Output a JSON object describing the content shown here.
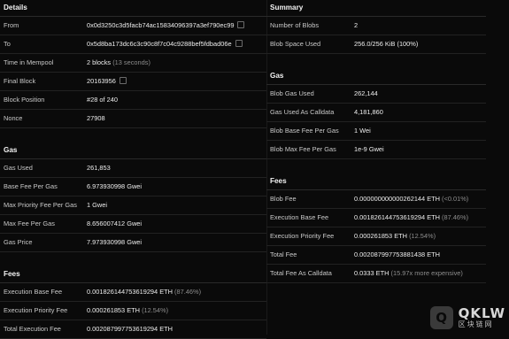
{
  "left": {
    "details": {
      "title": "Details",
      "rows": [
        {
          "label": "From",
          "value": "0x0d3250c3d5facb74ac15834096397a3ef790ec99",
          "copy": true
        },
        {
          "label": "To",
          "value": "0x5d8ba173dc6c3c90c8f7c04c9288bef5fdbad06e",
          "copy": true
        },
        {
          "label": "Time in Mempool",
          "value": "2 blocks",
          "note": "(13 seconds)"
        },
        {
          "label": "Final Block",
          "value": "20163956",
          "copy": true
        },
        {
          "label": "Block Position",
          "value": "#28 of 240"
        },
        {
          "label": "Nonce",
          "value": "27908"
        }
      ]
    },
    "gas": {
      "title": "Gas",
      "rows": [
        {
          "label": "Gas Used",
          "value": "261,853"
        },
        {
          "label": "Base Fee Per Gas",
          "value": "6.973930998 Gwei"
        },
        {
          "label": "Max Priority Fee Per Gas",
          "value": "1 Gwei"
        },
        {
          "label": "Max Fee Per Gas",
          "value": "8.656007412 Gwei"
        },
        {
          "label": "Gas Price",
          "value": "7.973930998 Gwei"
        }
      ]
    },
    "fees": {
      "title": "Fees",
      "rows": [
        {
          "label": "Execution Base Fee",
          "value": "0.001826144753619294 ETH",
          "note": "(87.46%)"
        },
        {
          "label": "Execution Priority Fee",
          "value": "0.000261853 ETH",
          "note": "(12.54%)"
        },
        {
          "label": "Total Execution Fee",
          "value": "0.002087997753619294 ETH"
        }
      ]
    }
  },
  "right": {
    "summary": {
      "title": "Summary",
      "rows": [
        {
          "label": "Number of Blobs",
          "value": "2"
        },
        {
          "label": "Blob Space Used",
          "value": "256.0/256 KiB (100%)"
        }
      ]
    },
    "gas": {
      "title": "Gas",
      "rows": [
        {
          "label": "Blob Gas Used",
          "value": "262,144"
        },
        {
          "label": "Gas Used As Calldata",
          "value": "4,181,860"
        },
        {
          "label": "Blob Base Fee Per Gas",
          "value": "1 Wei"
        },
        {
          "label": "Blob Max Fee Per Gas",
          "value": "1e-9 Gwei"
        }
      ]
    },
    "fees": {
      "title": "Fees",
      "rows": [
        {
          "label": "Blob Fee",
          "value": "0.000000000000262144 ETH",
          "note": "(<0.01%)"
        },
        {
          "label": "Execution Base Fee",
          "value": "0.001826144753619294 ETH",
          "note": "(87.46%)"
        },
        {
          "label": "Execution Priority Fee",
          "value": "0.000261853 ETH",
          "note": "(12.54%)"
        },
        {
          "label": "Total Fee",
          "value": "0.002087997753881438 ETH"
        },
        {
          "label": "Total Fee As Calldata",
          "value": "0.0333 ETH",
          "note": "(15.97x more expensive)"
        }
      ]
    }
  },
  "watermark": {
    "main": "QKLW",
    "sub": "区块链网"
  },
  "icons": {
    "copy": "copy-icon"
  }
}
